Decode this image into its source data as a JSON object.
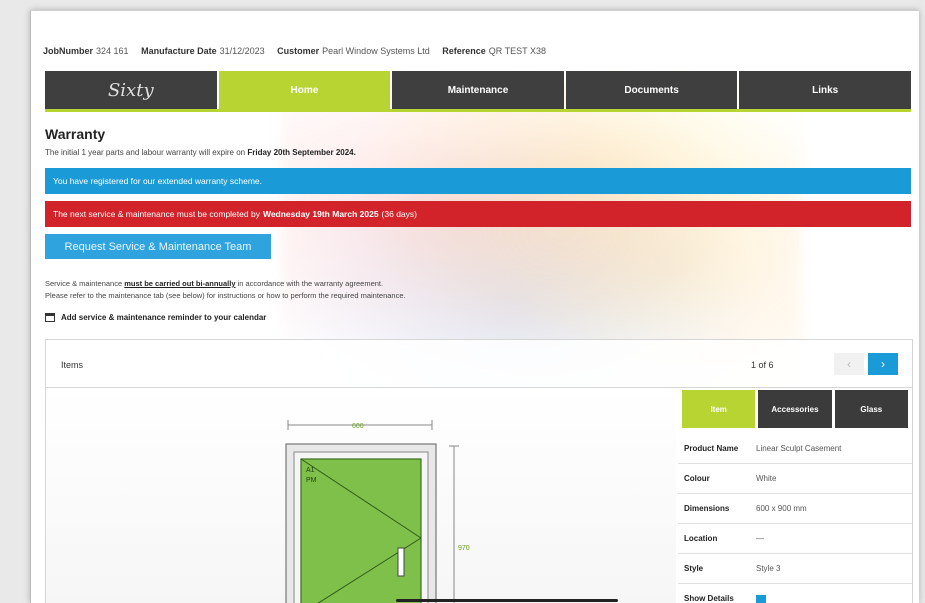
{
  "meta": {
    "job_label": "JobNumber",
    "job_value": "324 161",
    "mfg_label": "Manufacture Date",
    "mfg_value": "31/12/2023",
    "customer_label": "Customer",
    "customer_value": "Pearl Window Systems Ltd",
    "reference_label": "Reference",
    "reference_value": "QR TEST X38"
  },
  "nav": {
    "logo": "Sixty",
    "tabs": [
      "Home",
      "Maintenance",
      "Documents",
      "Links"
    ]
  },
  "warranty": {
    "title": "Warranty",
    "text_prefix": "The initial 1 year parts and labour warranty will expire on",
    "text_bold": "Friday 20th September 2024."
  },
  "alerts": {
    "blue": "You have registered for our extended warranty scheme.",
    "red_prefix": "The next service & maintenance must be completed by",
    "red_bold": "Wednesday 19th March 2025",
    "red_suffix": "(36 days)"
  },
  "service_button": "Request Service & Maintenance Team",
  "notes": {
    "line1_prefix": "Service & maintenance",
    "line1_link": "must be carried out bi-annually",
    "line1_suffix": "in accordance with the warranty agreement.",
    "line2": "Please refer to the maintenance tab (see below) for instructions or how to perform the required maintenance."
  },
  "calendar": "Add service & maintenance reminder to your calendar",
  "panel": {
    "items_label": "Items",
    "pager": "1 of 6",
    "prev_icon": "chevron-left-icon",
    "next_icon": "chevron-right-icon"
  },
  "drawing": {
    "width_label": "600",
    "height_label": "970",
    "sash_label_1": "A1",
    "sash_label_2": "PM"
  },
  "detail_tabs": [
    "Item",
    "Accessories",
    "Glass"
  ],
  "details": [
    {
      "key": "Product Name",
      "value": "Linear Sculpt Casement"
    },
    {
      "key": "Colour",
      "value": "White"
    },
    {
      "key": "Dimensions",
      "value": "600 x 900 mm"
    },
    {
      "key": "Location",
      "value": "—"
    },
    {
      "key": "Style",
      "value": "Style 3"
    },
    {
      "key": "Show Details",
      "value": ""
    }
  ],
  "colors": {
    "accent_green": "#b8d433",
    "accent_blue": "#1a9ad6",
    "alert_red": "#d2232a",
    "nav_dark": "#3f3f3f"
  }
}
